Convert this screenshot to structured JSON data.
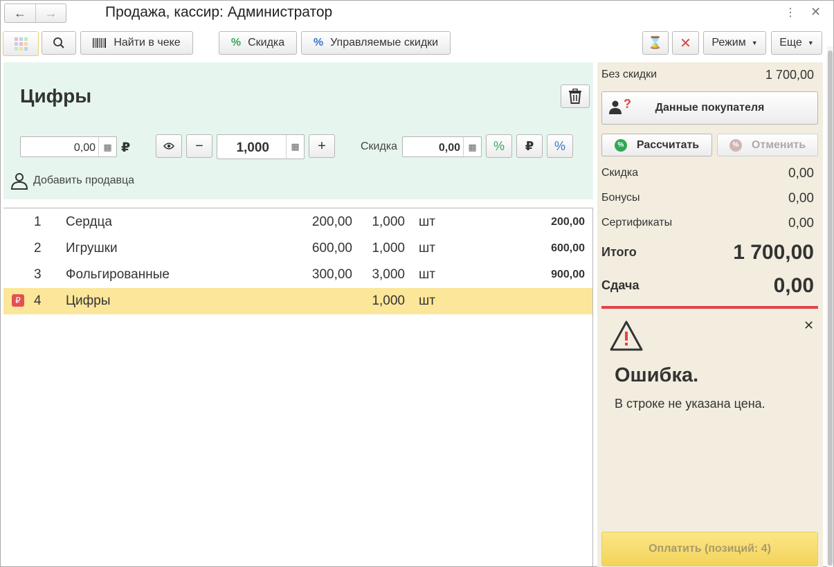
{
  "window": {
    "title": "Продажа, кассир: Администратор",
    "back_icon": "arrow-left-icon",
    "forward_icon": "arrow-right-icon",
    "more_icon": "vertical-dots-icon",
    "close_icon": "close-icon"
  },
  "toolbar": {
    "find_in_receipt": "Найти в чеке",
    "discount": "Скидка",
    "managed_discounts": "Управляемые скидки",
    "mode": "Режим",
    "more": "Еще"
  },
  "item_panel": {
    "name": "Цифры",
    "price_value": "0,00",
    "currency": "₽",
    "quantity_value": "1,000",
    "discount_label": "Скидка",
    "discount_value": "0,00",
    "add_seller": "Добавить продавца"
  },
  "receipt_rows": [
    {
      "n": "1",
      "name": "Сердца",
      "price": "200,00",
      "qty": "1,000",
      "unit": "шт",
      "sum": "200,00",
      "selected": false
    },
    {
      "n": "2",
      "name": "Игрушки",
      "price": "600,00",
      "qty": "1,000",
      "unit": "шт",
      "sum": "600,00",
      "selected": false
    },
    {
      "n": "3",
      "name": "Фольгированные",
      "price": "300,00",
      "qty": "3,000",
      "unit": "шт",
      "sum": "900,00",
      "selected": false
    },
    {
      "n": "4",
      "name": "Цифры",
      "price": "",
      "qty": "1,000",
      "unit": "шт",
      "sum": "",
      "selected": true
    }
  ],
  "summary": {
    "no_discount_label": "Без скидки",
    "no_discount_value": "1 700,00",
    "customer_data": "Данные покупателя",
    "calculate": "Рассчитать",
    "cancel": "Отменить",
    "discount_label": "Скидка",
    "discount_value": "0,00",
    "bonuses_label": "Бонусы",
    "bonuses_value": "0,00",
    "certificates_label": "Сертификаты",
    "certificates_value": "0,00",
    "total_label": "Итого",
    "total_value": "1 700,00",
    "change_label": "Сдача",
    "change_value": "0,00",
    "pay": "Оплатить (позиций: 4)"
  },
  "error": {
    "title": "Ошибка.",
    "message": "В строке не указана цена."
  },
  "colors": {
    "item_panel_bg": "#e6f6ee",
    "summary_bg": "#f2eddf",
    "selected_row": "#fbe69a",
    "error_red": "#e2434a",
    "pay_yellow": "#f3d35a"
  }
}
